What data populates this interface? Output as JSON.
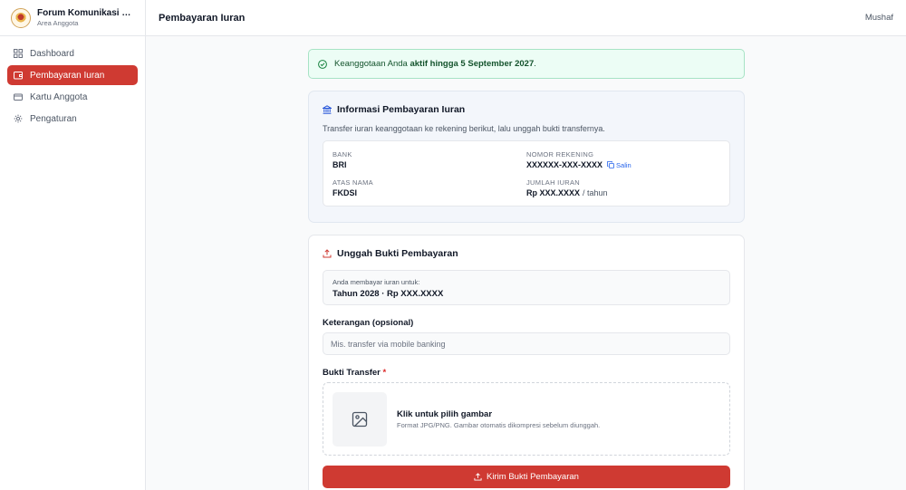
{
  "brand": {
    "title": "Forum Komunikasi Do...",
    "subtitle": "Area Anggota"
  },
  "sidebar": {
    "items": [
      {
        "label": "Dashboard",
        "icon": "grid-icon"
      },
      {
        "label": "Pembayaran Iuran",
        "icon": "wallet-icon",
        "active": true
      },
      {
        "label": "Kartu Anggota",
        "icon": "card-icon"
      },
      {
        "label": "Pengaturan",
        "icon": "gear-icon"
      }
    ]
  },
  "header": {
    "title": "Pembayaran Iuran",
    "user": "Mushaf"
  },
  "alert": {
    "prefix": "Keanggotaan Anda ",
    "status": "aktif hingga 5 September 2027",
    "suffix": "."
  },
  "info": {
    "title": "Informasi Pembayaran Iuran",
    "description": "Transfer iuran keanggotaan ke rekening berikut, lalu unggah bukti transfernya.",
    "bank_label": "BANK",
    "bank_value": "BRI",
    "account_label": "NOMOR REKENING",
    "account_value": "XXXXXX-XXX-XXXX",
    "copy_label": "Salin",
    "holder_label": "ATAS NAMA",
    "holder_value": "FKDSI",
    "amount_label": "JUMLAH IURAN",
    "amount_value": "Rp XXX.XXXX",
    "amount_suffix": "/ tahun"
  },
  "upload": {
    "title": "Unggah Bukti Pembayaran",
    "pay_label": "Anda membayar iuran untuk:",
    "pay_value": "Tahun 2028 · Rp XXX.XXXX",
    "note_label": "Keterangan (opsional)",
    "note_placeholder": "Mis. transfer via mobile banking",
    "note_value": "",
    "proof_label": "Bukti Transfer",
    "required_mark": "*",
    "dropzone_title": "Klik untuk pilih gambar",
    "dropzone_sub": "Format JPG/PNG. Gambar otomatis dikompresi sebelum diunggah.",
    "submit_label": "Kirim Bukti Pembayaran"
  },
  "colors": {
    "accent": "#cf3a32",
    "success_bg": "#ecfdf5",
    "success_border": "#a7e3c5",
    "link": "#2563eb"
  }
}
